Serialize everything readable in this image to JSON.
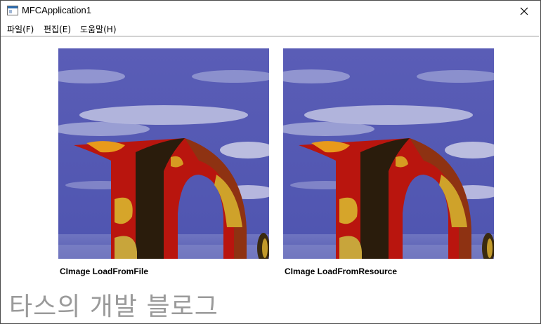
{
  "window": {
    "title": "MFCApplication1",
    "icon": "mfc-app-icon",
    "close_icon": "close-icon"
  },
  "menu": [
    {
      "label": "파일(F)"
    },
    {
      "label": "편집(E)"
    },
    {
      "label": "도움말(H)"
    }
  ],
  "images": [
    {
      "caption": "CImage LoadFromFile"
    },
    {
      "caption": "CImage LoadFromResource"
    }
  ],
  "watermark": "타스의 개발 블로그",
  "colors": {
    "sky": "#5a5fb8",
    "letter_red": "#c0160e",
    "letter_yellow": "#d7a522",
    "letter_dark": "#2a1c0c"
  }
}
